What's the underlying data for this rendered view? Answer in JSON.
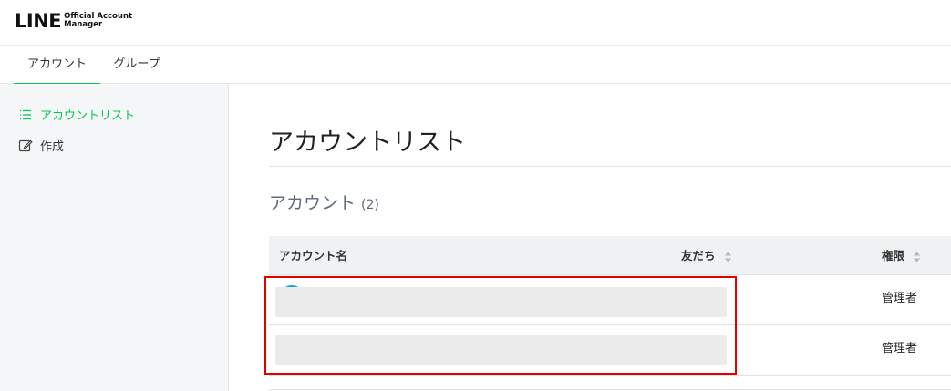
{
  "app": {
    "logo_main": "LINE",
    "logo_sub_line1": "Official Account",
    "logo_sub_line2": "Manager"
  },
  "tabs": [
    {
      "label": "アカウント",
      "active": true
    },
    {
      "label": "グループ",
      "active": false
    }
  ],
  "sidebar": {
    "items": [
      {
        "label": "アカウントリスト",
        "icon": "list-icon",
        "active": true
      },
      {
        "label": "作成",
        "icon": "edit-icon",
        "active": false
      }
    ]
  },
  "main": {
    "title": "アカウントリスト",
    "section_title": "アカウント",
    "section_count": "(2)",
    "table": {
      "columns": [
        "アカウント名",
        "友だち",
        "権限"
      ],
      "rows": [
        {
          "name": "",
          "friends": "",
          "role": "管理者"
        },
        {
          "name": "",
          "friends": "",
          "role": "管理者"
        }
      ]
    }
  },
  "colors": {
    "accent": "#06c755",
    "highlight": "#e00000"
  }
}
